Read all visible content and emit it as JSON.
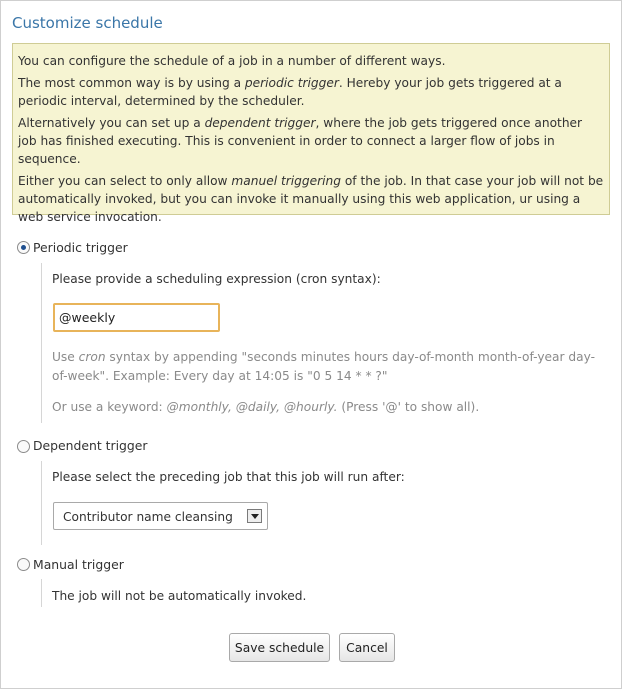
{
  "title": "Customize schedule",
  "info": {
    "p1": "You can configure the schedule of a job in a number of different ways.",
    "p2_pre": "The most common way is by using a ",
    "p2_em": "periodic trigger",
    "p2_post": ". Hereby your job gets triggered at a periodic interval, determined by the scheduler.",
    "p3_pre": "Alternatively you can set up a ",
    "p3_em": "dependent trigger",
    "p3_post": ", where the job gets triggered once another job has finished executing. This is convenient in order to connect a larger flow of jobs in sequence.",
    "p4_pre": "Either you can select to only allow ",
    "p4_em": "manuel triggering",
    "p4_post": " of the job. In that case your job will not be automatically invoked, but you can invoke it manually using this web application, ur using a web service invocation."
  },
  "periodic": {
    "label": "Periodic trigger",
    "selected": true,
    "prompt": "Please provide a scheduling expression (cron syntax):",
    "input_value": "@weekly",
    "help1_pre": "Use ",
    "help1_em": "cron",
    "help1_post": " syntax by appending \"seconds minutes hours day-of-month month-of-year day-of-week\". Example: Every day at 14:05 is \"0 5 14 * * ?\"",
    "help2_pre": "Or use a keyword: ",
    "help2_em": "@monthly, @daily, @hourly.",
    "help2_post": " (Press '@' to show all)."
  },
  "dependent": {
    "label": "Dependent trigger",
    "selected": false,
    "prompt": "Please select the preceding job that this job will run after:",
    "selected_job": "Contributor name cleansing"
  },
  "manual": {
    "label": "Manual trigger",
    "selected": false,
    "note": "The job will not be automatically invoked."
  },
  "buttons": {
    "save": "Save schedule",
    "cancel": "Cancel"
  },
  "colors": {
    "title": "#3a76a8",
    "info_bg": "#f6f4d2",
    "input_focus_border": "#e8b45a"
  }
}
